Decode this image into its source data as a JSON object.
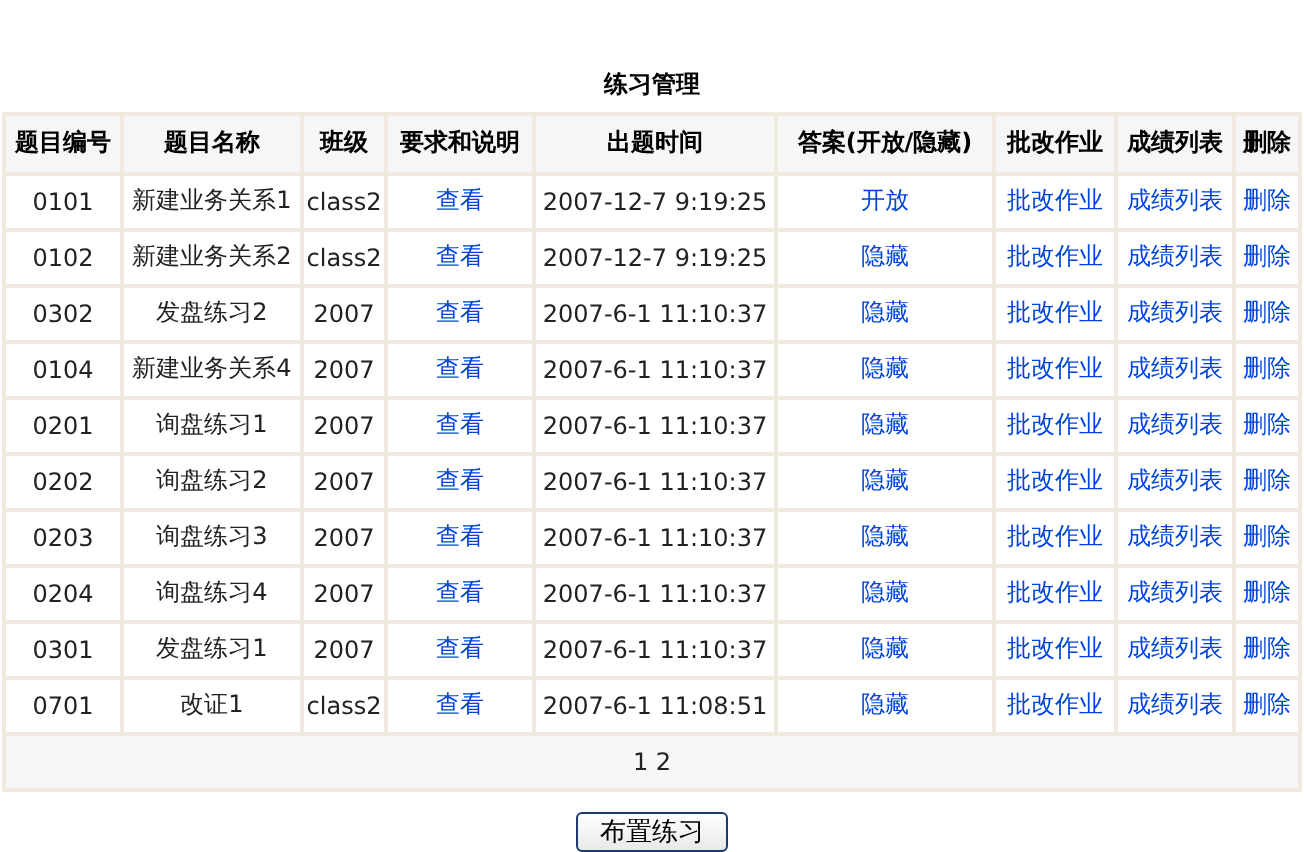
{
  "title": "练习管理",
  "columns": [
    "题目编号",
    "题目名称",
    "班级",
    "要求和说明",
    "出题时间",
    "答案(开放/隐藏)",
    "批改作业",
    "成绩列表",
    "删除"
  ],
  "rows": [
    {
      "id": "0101",
      "name": "新建业务关系1",
      "class": "class2",
      "details": "查看",
      "time": "2007-12-7 9:19:25",
      "answer": "开放",
      "grade": "批改作业",
      "scores": "成绩列表",
      "delete": "删除"
    },
    {
      "id": "0102",
      "name": "新建业务关系2",
      "class": "class2",
      "details": "查看",
      "time": "2007-12-7 9:19:25",
      "answer": "隐藏",
      "grade": "批改作业",
      "scores": "成绩列表",
      "delete": "删除"
    },
    {
      "id": "0302",
      "name": "发盘练习2",
      "class": "2007",
      "details": "查看",
      "time": "2007-6-1 11:10:37",
      "answer": "隐藏",
      "grade": "批改作业",
      "scores": "成绩列表",
      "delete": "删除"
    },
    {
      "id": "0104",
      "name": "新建业务关系4",
      "class": "2007",
      "details": "查看",
      "time": "2007-6-1 11:10:37",
      "answer": "隐藏",
      "grade": "批改作业",
      "scores": "成绩列表",
      "delete": "删除"
    },
    {
      "id": "0201",
      "name": "询盘练习1",
      "class": "2007",
      "details": "查看",
      "time": "2007-6-1 11:10:37",
      "answer": "隐藏",
      "grade": "批改作业",
      "scores": "成绩列表",
      "delete": "删除"
    },
    {
      "id": "0202",
      "name": "询盘练习2",
      "class": "2007",
      "details": "查看",
      "time": "2007-6-1 11:10:37",
      "answer": "隐藏",
      "grade": "批改作业",
      "scores": "成绩列表",
      "delete": "删除"
    },
    {
      "id": "0203",
      "name": "询盘练习3",
      "class": "2007",
      "details": "查看",
      "time": "2007-6-1 11:10:37",
      "answer": "隐藏",
      "grade": "批改作业",
      "scores": "成绩列表",
      "delete": "删除"
    },
    {
      "id": "0204",
      "name": "询盘练习4",
      "class": "2007",
      "details": "查看",
      "time": "2007-6-1 11:10:37",
      "answer": "隐藏",
      "grade": "批改作业",
      "scores": "成绩列表",
      "delete": "删除"
    },
    {
      "id": "0301",
      "name": "发盘练习1",
      "class": "2007",
      "details": "查看",
      "time": "2007-6-1 11:10:37",
      "answer": "隐藏",
      "grade": "批改作业",
      "scores": "成绩列表",
      "delete": "删除"
    },
    {
      "id": "0701",
      "name": "改证1",
      "class": "class2",
      "details": "查看",
      "time": "2007-6-1 11:08:51",
      "answer": "隐藏",
      "grade": "批改作业",
      "scores": "成绩列表",
      "delete": "删除"
    }
  ],
  "pager": "1 2",
  "button": "布置练习"
}
